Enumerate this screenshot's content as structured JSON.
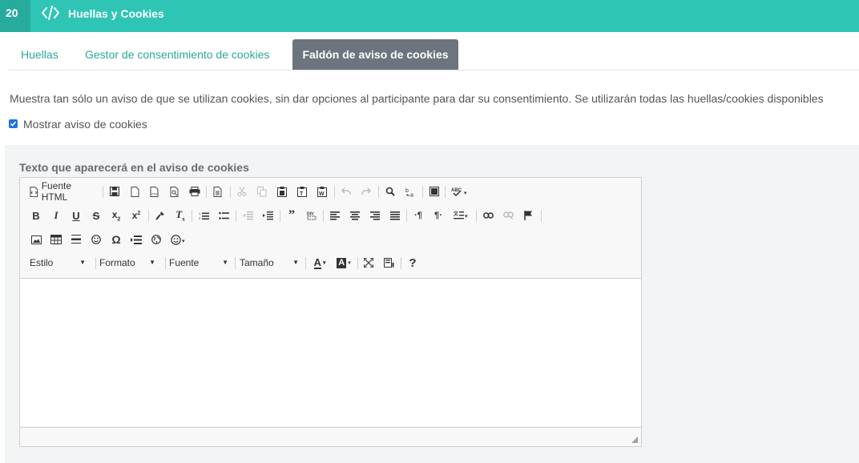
{
  "header": {
    "number": "20",
    "title": "Huellas y Cookies",
    "icon": "code-icon"
  },
  "tabs": [
    {
      "label": "Huellas",
      "active": false
    },
    {
      "label": "Gestor de consentimiento de cookies",
      "active": false
    },
    {
      "label": "Faldón de aviso de cookies",
      "active": true
    }
  ],
  "description": "Muestra tan sólo un aviso de que se utilizan cookies, sin dar opciones al participante para dar su consentimiento. Se utilizarán todas las huellas/cookies disponibles",
  "checkbox": {
    "label": "Mostrar aviso de cookies",
    "checked": true
  },
  "editor": {
    "label": "Texto que aparecerá en el aviso de cookies",
    "source_label": "Fuente HTML",
    "combos": {
      "style": "Estilo",
      "format": "Formato",
      "font": "Fuente",
      "size": "Tamaño"
    }
  },
  "colors": {
    "accent": "#2fc5b4",
    "accent_dark": "#26ab9c",
    "active_tab": "#6c757d",
    "checkbox": "#1e73e8"
  }
}
